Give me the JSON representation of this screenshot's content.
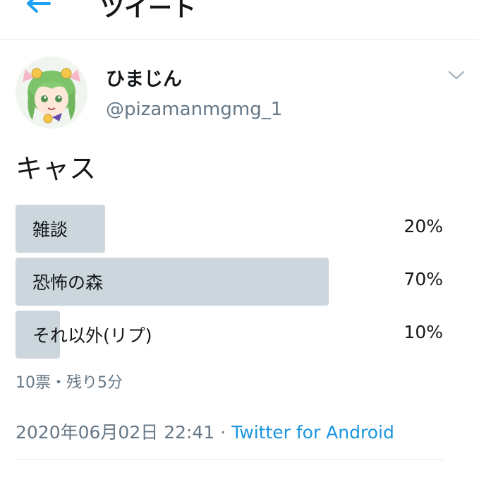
{
  "header": {
    "title": "ツイート",
    "back_icon": "arrow-left-icon"
  },
  "author": {
    "display_name": "ひまじん",
    "username": "@pizamanmgmg_1",
    "avatar_icon": "anime-avatar"
  },
  "tweet": {
    "text": "キャス"
  },
  "poll": {
    "options": [
      {
        "label": "雑談",
        "percent_text": "20%",
        "percent": 20
      },
      {
        "label": "恐怖の森",
        "percent_text": "70%",
        "percent": 70
      },
      {
        "label": "それ以外(リプ)",
        "percent_text": "10%",
        "percent": 10
      }
    ],
    "meta": "10票・残り5分"
  },
  "footer": {
    "timestamp": "2020年06月02日 22:41",
    "separator": "·",
    "source": "Twitter for Android"
  },
  "colors": {
    "accent": "#1b95e0",
    "poll_fill": "#ccd6dd",
    "secondary_text": "#657786",
    "divider": "#e1e8ed"
  }
}
